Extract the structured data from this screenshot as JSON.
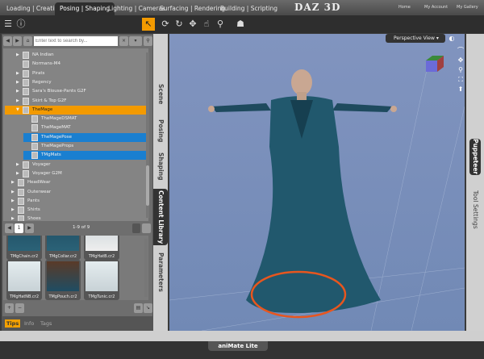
{
  "topbar": {
    "tabs": [
      "Loading | Creating",
      "Posing | Shaping",
      "Lighting | Cameras",
      "Surfacing | Rendering",
      "Building | Scripting"
    ],
    "active_tab": "Posing | Shaping",
    "logo": "DAZ 3D",
    "links": [
      "Home",
      "My Account",
      "My Gallery"
    ]
  },
  "toolbar": {
    "icons": [
      "menu-icon",
      "help-icon",
      "select-tool-icon",
      "universal-tool-icon",
      "rotate-tool-icon",
      "translate-tool-icon",
      "pose-tool-icon",
      "joint-tool-icon",
      "figure-tool-icon"
    ]
  },
  "content_library": {
    "search_placeholder": "Enter text to search by...",
    "tree": [
      {
        "label": "NA Indian",
        "level": 2,
        "expandable": true
      },
      {
        "label": "Normans-M4",
        "level": 2,
        "expandable": false
      },
      {
        "label": "Pirats",
        "level": 2,
        "expandable": true
      },
      {
        "label": "Regency",
        "level": 2,
        "expandable": true
      },
      {
        "label": "Sara's Blouse-Pants G2F",
        "level": 2,
        "expandable": true
      },
      {
        "label": "Skirt & Top G2F",
        "level": 2,
        "expandable": true
      },
      {
        "label": "TheMage",
        "level": 2,
        "expanded": true,
        "state": "highlighted"
      },
      {
        "label": "TheMageDSMAT",
        "level": 3
      },
      {
        "label": "TheMageMAT",
        "level": 3
      },
      {
        "label": "TheMagePose",
        "level": 3,
        "state": "selected"
      },
      {
        "label": "TheMageProps",
        "level": 3
      },
      {
        "label": "TMgMats",
        "level": 3,
        "state": "selected"
      },
      {
        "label": "Voyager",
        "level": 2,
        "expandable": true
      },
      {
        "label": "Voyager G2M",
        "level": 2,
        "expandable": true
      },
      {
        "label": "HeadWear",
        "level": 1,
        "expandable": true
      },
      {
        "label": "Outerwear",
        "level": 1,
        "expandable": true
      },
      {
        "label": "Pants",
        "level": 1,
        "expandable": true
      },
      {
        "label": "Shirts",
        "level": 1,
        "expandable": true
      },
      {
        "label": "Shoes",
        "level": 1,
        "expandable": true
      }
    ],
    "page": "1",
    "page_range": "1-9 of 9",
    "thumbnails": [
      "TMgChain.cr2",
      "TMgCollar.cr2",
      "TMgHatB.cr2",
      "TMgHatNB.cr2",
      "TMgPouch.cr2",
      "TMgTunic.cr2"
    ],
    "bottom_tabs": [
      "Tips",
      "Info",
      "Tags"
    ],
    "active_bottom_tab": "Tips"
  },
  "side_tabs": [
    "Scene",
    "Posing",
    "Shaping",
    "Content Library",
    "Parameters"
  ],
  "active_side_tab": "Content Library",
  "viewport": {
    "view_label": "Perspective View",
    "highlight_color": "#e8561e"
  },
  "right_tabs": [
    "Puppeteer",
    "Tool Settings"
  ],
  "active_right_tab": "Puppeteer",
  "bottom_panel": {
    "label": "aniMate Lite"
  },
  "colors": {
    "highlight": "#f39a00",
    "selection": "#1a7fd0",
    "viewport": "#7a8fba"
  }
}
